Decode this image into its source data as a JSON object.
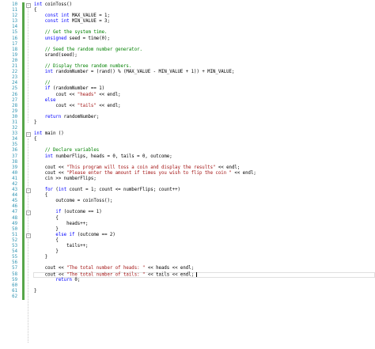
{
  "editor": {
    "lines": [
      {
        "n": "10",
        "fold": "−",
        "segs": [
          [
            "kw",
            "int"
          ],
          [
            "t",
            " coinToss()"
          ]
        ]
      },
      {
        "n": "11",
        "segs": [
          [
            "t",
            "{"
          ]
        ]
      },
      {
        "n": "12",
        "segs": [
          [
            "t",
            "    "
          ],
          [
            "kw",
            "const"
          ],
          [
            "t",
            " "
          ],
          [
            "kw",
            "int"
          ],
          [
            "t",
            " MAX_VALUE = 1;"
          ]
        ]
      },
      {
        "n": "13",
        "segs": [
          [
            "t",
            "    "
          ],
          [
            "kw",
            "const"
          ],
          [
            "t",
            " "
          ],
          [
            "kw",
            "int"
          ],
          [
            "t",
            " MIN_VALUE = 3;"
          ]
        ]
      },
      {
        "n": "14",
        "segs": []
      },
      {
        "n": "15",
        "segs": [
          [
            "t",
            "    "
          ],
          [
            "cm",
            "// Get the system time."
          ]
        ]
      },
      {
        "n": "16",
        "segs": [
          [
            "t",
            "    "
          ],
          [
            "kw",
            "unsigned"
          ],
          [
            "t",
            " seed = time(0);"
          ]
        ]
      },
      {
        "n": "17",
        "segs": []
      },
      {
        "n": "18",
        "segs": [
          [
            "t",
            "    "
          ],
          [
            "cm",
            "// Seed the random number generator."
          ]
        ]
      },
      {
        "n": "19",
        "segs": [
          [
            "t",
            "    srand(seed);"
          ]
        ]
      },
      {
        "n": "20",
        "segs": []
      },
      {
        "n": "21",
        "segs": [
          [
            "t",
            "    "
          ],
          [
            "cm",
            "// Display three random numbers."
          ]
        ]
      },
      {
        "n": "22",
        "segs": [
          [
            "t",
            "    "
          ],
          [
            "kw",
            "int"
          ],
          [
            "t",
            " randomNumber = (rand() % (MAX_VALUE - MIN_VALUE + 1)) + MIN_VALUE;"
          ]
        ]
      },
      {
        "n": "23",
        "segs": []
      },
      {
        "n": "24",
        "segs": [
          [
            "t",
            "    "
          ],
          [
            "cm",
            "//"
          ]
        ]
      },
      {
        "n": "25",
        "segs": [
          [
            "t",
            "    "
          ],
          [
            "kw",
            "if"
          ],
          [
            "t",
            " (randomNumber == 1)"
          ]
        ]
      },
      {
        "n": "26",
        "segs": [
          [
            "t",
            "        cout << "
          ],
          [
            "str",
            "\"heads\""
          ],
          [
            "t",
            " << endl;"
          ]
        ]
      },
      {
        "n": "27",
        "segs": [
          [
            "t",
            "    "
          ],
          [
            "kw",
            "else"
          ]
        ]
      },
      {
        "n": "28",
        "segs": [
          [
            "t",
            "        cout << "
          ],
          [
            "str",
            "\"tails\""
          ],
          [
            "t",
            " << endl;"
          ]
        ]
      },
      {
        "n": "29",
        "segs": []
      },
      {
        "n": "30",
        "segs": [
          [
            "t",
            "    "
          ],
          [
            "kw",
            "return"
          ],
          [
            "t",
            " randomNumber;"
          ]
        ]
      },
      {
        "n": "31",
        "segs": [
          [
            "t",
            "}"
          ]
        ]
      },
      {
        "n": "32",
        "segs": []
      },
      {
        "n": "33",
        "fold": "−",
        "segs": [
          [
            "kw",
            "int"
          ],
          [
            "t",
            " main ()"
          ]
        ]
      },
      {
        "n": "34",
        "segs": [
          [
            "t",
            "{"
          ]
        ]
      },
      {
        "n": "35",
        "segs": []
      },
      {
        "n": "36",
        "segs": [
          [
            "t",
            "    "
          ],
          [
            "cm",
            "// Declare variables"
          ]
        ]
      },
      {
        "n": "37",
        "segs": [
          [
            "t",
            "    "
          ],
          [
            "kw",
            "int"
          ],
          [
            "t",
            " numberFlips, heads = 0, tails = 0, outcome;"
          ]
        ]
      },
      {
        "n": "38",
        "segs": []
      },
      {
        "n": "39",
        "segs": [
          [
            "t",
            "    cout << "
          ],
          [
            "str",
            "\"This program will toss a coin and display the results\""
          ],
          [
            "t",
            " << endl;"
          ]
        ]
      },
      {
        "n": "40",
        "segs": [
          [
            "t",
            "    cout << "
          ],
          [
            "str",
            "\"Please enter the amount if times you wish to flip the coin \""
          ],
          [
            "t",
            " << endl;"
          ]
        ]
      },
      {
        "n": "41",
        "segs": [
          [
            "t",
            "    cin >> numberFlips;"
          ]
        ]
      },
      {
        "n": "42",
        "segs": []
      },
      {
        "n": "43",
        "fold": "−",
        "segs": [
          [
            "t",
            "    "
          ],
          [
            "kw",
            "for"
          ],
          [
            "t",
            " ("
          ],
          [
            "kw",
            "int"
          ],
          [
            "t",
            " count = 1; count <= numberFlips; count++)"
          ]
        ]
      },
      {
        "n": "44",
        "segs": [
          [
            "t",
            "    {"
          ]
        ]
      },
      {
        "n": "45",
        "segs": [
          [
            "t",
            "        outcome = coinToss();"
          ]
        ]
      },
      {
        "n": "46",
        "segs": []
      },
      {
        "n": "47",
        "fold": "−",
        "segs": [
          [
            "t",
            "        "
          ],
          [
            "kw",
            "if"
          ],
          [
            "t",
            " (outcome == 1)"
          ]
        ]
      },
      {
        "n": "48",
        "segs": [
          [
            "t",
            "        {"
          ]
        ]
      },
      {
        "n": "49",
        "segs": [
          [
            "t",
            "            heads++;"
          ]
        ]
      },
      {
        "n": "50",
        "segs": [
          [
            "t",
            "        }"
          ]
        ]
      },
      {
        "n": "51",
        "fold": "−",
        "segs": [
          [
            "t",
            "        "
          ],
          [
            "kw",
            "else"
          ],
          [
            "t",
            " "
          ],
          [
            "kw",
            "if"
          ],
          [
            "t",
            " (outcome == 2)"
          ]
        ]
      },
      {
        "n": "52",
        "segs": [
          [
            "t",
            "        {"
          ]
        ]
      },
      {
        "n": "53",
        "segs": [
          [
            "t",
            "            tails++;"
          ]
        ]
      },
      {
        "n": "54",
        "segs": [
          [
            "t",
            "        }"
          ]
        ]
      },
      {
        "n": "55",
        "segs": [
          [
            "t",
            "    }"
          ]
        ]
      },
      {
        "n": "56",
        "segs": []
      },
      {
        "n": "57",
        "segs": [
          [
            "t",
            "    cout << "
          ],
          [
            "str",
            "\"The total number of heads: \""
          ],
          [
            "t",
            " << heads << endl;"
          ]
        ]
      },
      {
        "n": "58",
        "current": true,
        "segs": [
          [
            "t",
            "    cout << "
          ],
          [
            "str",
            "\"The total number of tails: \""
          ],
          [
            "t",
            " << tails << endl; "
          ],
          [
            "caret",
            ""
          ]
        ]
      },
      {
        "n": "59",
        "segs": [
          [
            "t",
            "        "
          ],
          [
            "kw",
            "return"
          ],
          [
            "t",
            " 0;"
          ]
        ]
      },
      {
        "n": "60",
        "segs": []
      },
      {
        "n": "61",
        "segs": [
          [
            "t",
            "}"
          ]
        ]
      },
      {
        "n": "62",
        "segs": []
      }
    ]
  },
  "colors": {
    "keyword": "#0000ff",
    "string": "#a31515",
    "comment": "#008000",
    "line_number": "#2b91af",
    "changed_marker": "#57a64a"
  }
}
